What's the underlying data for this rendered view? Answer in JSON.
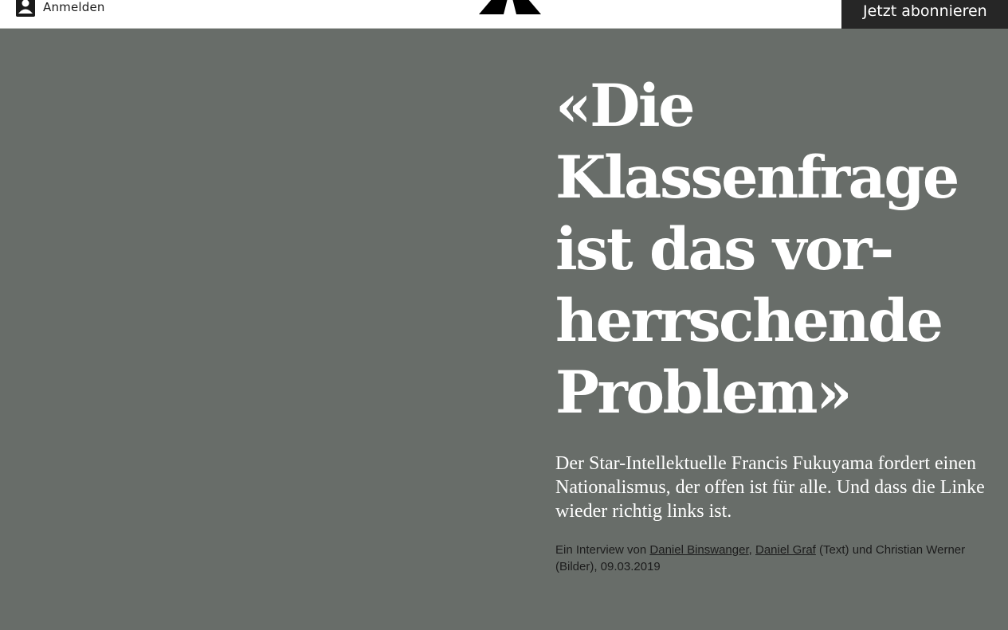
{
  "header": {
    "login_label": "Anmelden",
    "login_icon": "user-icon",
    "logo_icon": "republik-logo",
    "subscribe_label": "Jetzt abonnieren"
  },
  "article": {
    "title_lines": [
      "«Die",
      "Klassenfrage",
      "ist das vor-",
      "herrschende",
      "Problem»"
    ],
    "lead": "Der Star-Intellektuelle Francis Fukuyama fordert einen Nationalismus, der offen ist für alle. Und dass die Linke wieder richtig links ist.",
    "byline": {
      "prefix": "Ein Interview von ",
      "author1": "Daniel Binswanger",
      "sep1": ", ",
      "author2": "Daniel Graf",
      "suffix": " (Text) und Christian Werner (Bilder), 09.03.2019"
    }
  },
  "colors": {
    "background": "#686d69",
    "header_bg": "#ffffff",
    "subscribe_bg": "#262626",
    "headline_text": "#ffffff"
  }
}
